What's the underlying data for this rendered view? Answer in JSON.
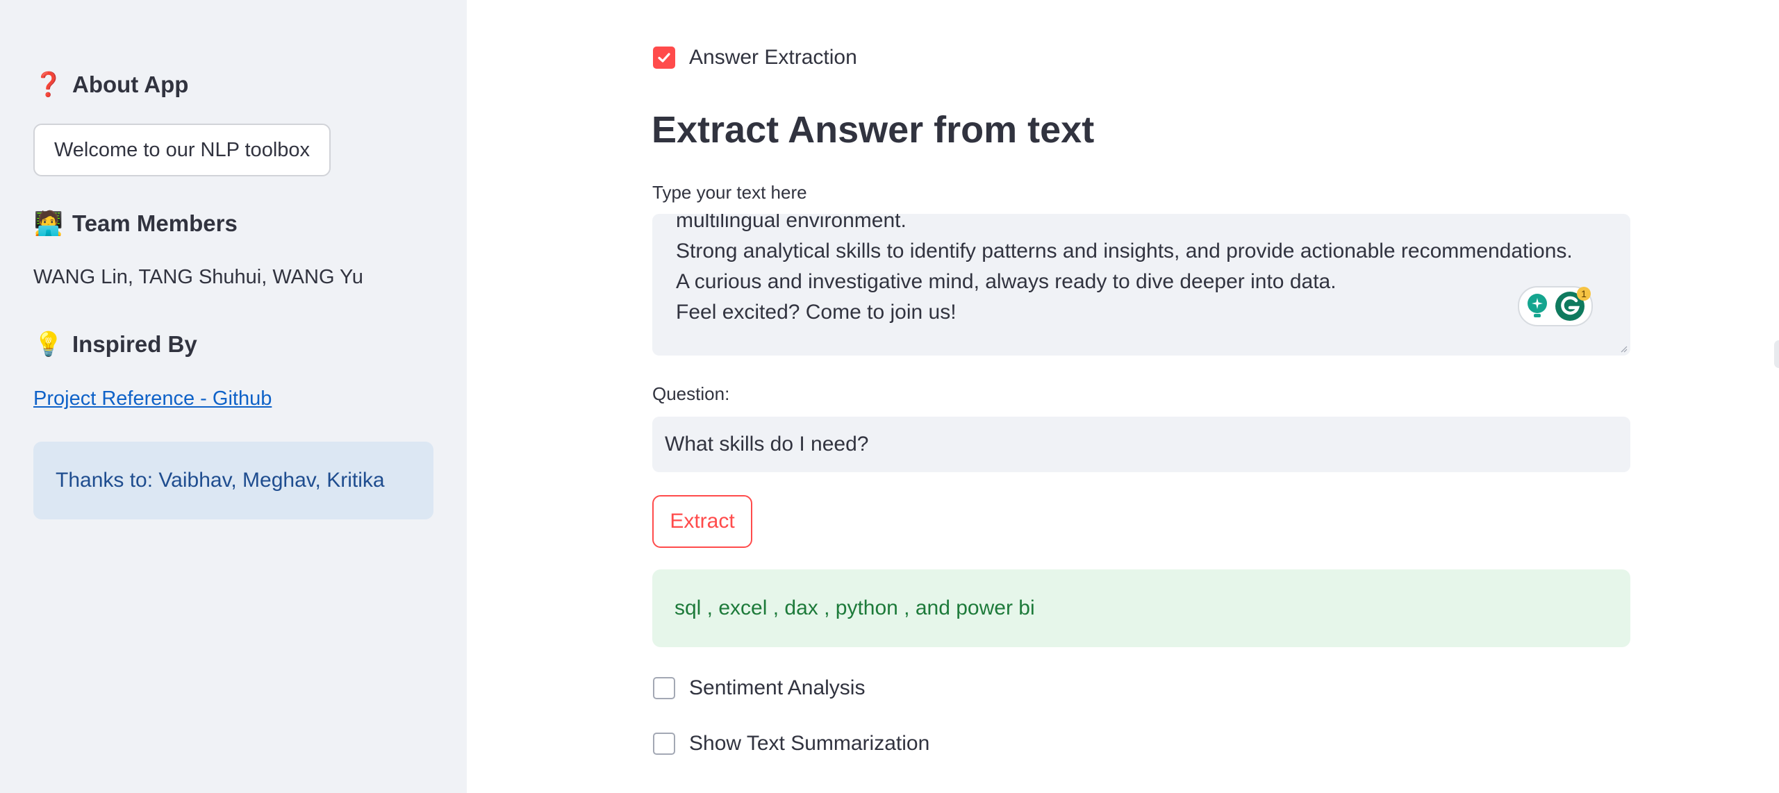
{
  "sidebar": {
    "about": {
      "emoji": "❓",
      "title": "About App",
      "button_label": "Welcome to our NLP toolbox"
    },
    "team": {
      "emoji": "🧑‍💻",
      "title": "Team Members",
      "members": "WANG Lin, TANG Shuhui, WANG Yu"
    },
    "inspired": {
      "emoji": "💡",
      "title": "Inspired By",
      "link_text": "Project Reference - Github"
    },
    "thanks": "Thanks to: Vaibhav, Meghav, Kritika"
  },
  "main": {
    "answer_extraction": {
      "label": "Answer Extraction",
      "checked": true
    },
    "title": "Extract Answer from text",
    "text_label": "Type your text here",
    "text_lines": [
      "multilingual environment.",
      "Strong analytical skills to identify patterns and insights, and provide actionable recommendations.",
      "A curious and investigative mind, always ready to dive deeper into data.",
      "Feel excited? Come to join us!"
    ],
    "grammarly_badge": "1",
    "question_label": "Question:",
    "question_value": "What skills do I need?",
    "extract_button": "Extract",
    "answer": "sql , excel , dax , python , and power bi",
    "sentiment": {
      "label": "Sentiment Analysis",
      "checked": false
    },
    "summarization": {
      "label": "Show Text Summarization",
      "checked": false
    }
  },
  "colors": {
    "accent": "#ff4b4b",
    "sidebar_bg": "#f0f2f6",
    "info_bg": "#dce7f3",
    "success_bg": "#e6f6ea",
    "success_text": "#1d7a3a",
    "link": "#0f62c8"
  }
}
